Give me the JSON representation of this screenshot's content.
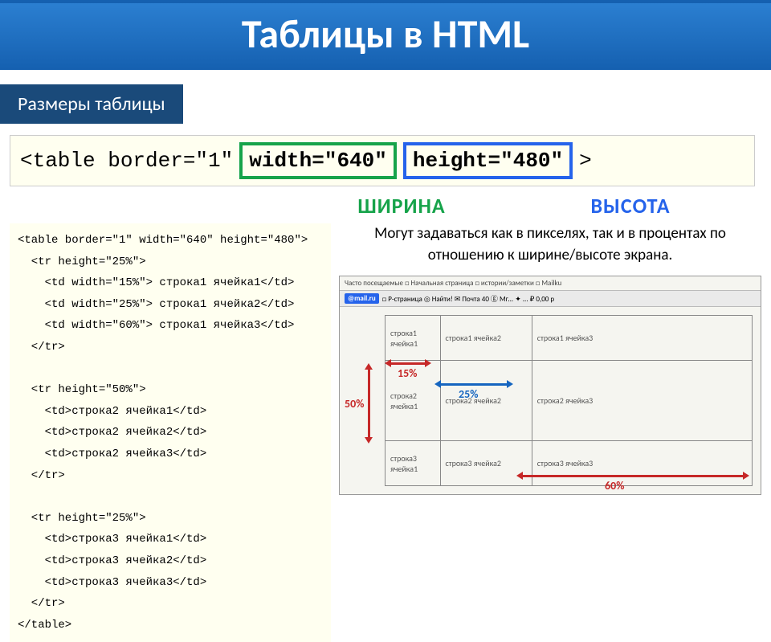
{
  "title": "Таблицы в HTML",
  "subheading": "Размеры таблицы",
  "code_banner": {
    "prefix": "<table border=\"1\"",
    "width_attr": "width=\"640\"",
    "height_attr": "height=\"480\"",
    "suffix": ">"
  },
  "labels": {
    "width": "ШИРИНА",
    "height": "ВЫСОТА"
  },
  "source_code": "<table border=\"1\" width=\"640\" height=\"480\">\n  <tr height=\"25%\">\n    <td width=\"15%\"> строка1 ячейка1</td>\n    <td width=\"25%\"> строка1 ячейка2</td>\n    <td width=\"60%\"> строка1 ячейка3</td>\n  </tr>\n\n  <tr height=\"50%\">\n    <td>строка2 ячейка1</td>\n    <td>строка2 ячейка2</td>\n    <td>строка2 ячейка3</td>\n  </tr>\n\n  <tr height=\"25%\">\n    <td>строка3 ячейка1</td>\n    <td>строка3 ячейка2</td>\n    <td>строка3 ячейка3</td>\n  </tr>\n</table>",
  "description": "Могут задаваться как в пикселях, так и в процентах по отношению к ширине/высоте экрана.",
  "browser": {
    "toolbar1": "Часто посещаемые  □ Начальная страница  □  истории/заметки  □ Mailku",
    "mail_badge": "@mail.ru",
    "toolbar2": "□ Р-страница  ◎ Найти!  ✉ Почта 40  ⓖ Мг...  ✦ ...  ₽ 0,00 р"
  },
  "demo_cells": {
    "r1c1": "строка1\nячейка1",
    "r1c2": "строка1 ячейка2",
    "r1c3": "строка1 ячейка3",
    "r2c1": "строка2\nячейка1",
    "r2c2": "строка2 ячейка2",
    "r2c3": "строка2 ячейка3",
    "r3c1": "строка3\nячейка1",
    "r3c2": "строка3 ячейка2",
    "r3c3": "строка3 ячейка3"
  },
  "percentages": {
    "col1": "15%",
    "col2": "25%",
    "row2": "50%",
    "col3": "60%"
  }
}
